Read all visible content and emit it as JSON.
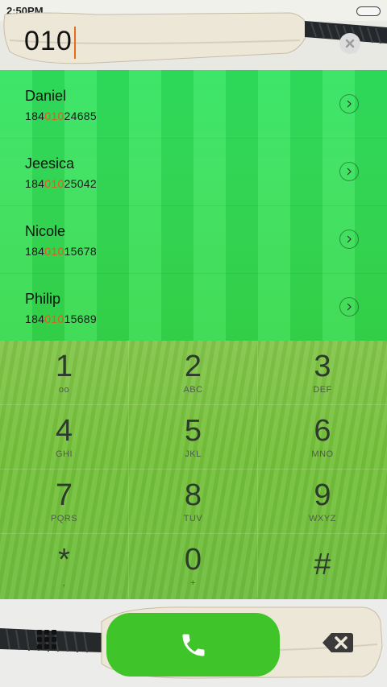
{
  "status": {
    "time": "2:50PM"
  },
  "dial": {
    "input": "010"
  },
  "contacts": [
    {
      "name": "Daniel",
      "number_pre": "184",
      "number_match": "010",
      "number_post": "24685"
    },
    {
      "name": "Jeesica",
      "number_pre": "184",
      "number_match": "010",
      "number_post": "25042"
    },
    {
      "name": "Nicole",
      "number_pre": "184",
      "number_match": "010",
      "number_post": "15678"
    },
    {
      "name": "Philip",
      "number_pre": "184",
      "number_match": "010",
      "number_post": "15689"
    }
  ],
  "keys": [
    {
      "digit": "1",
      "sub": "oo"
    },
    {
      "digit": "2",
      "sub": "ABC"
    },
    {
      "digit": "3",
      "sub": "DEF"
    },
    {
      "digit": "4",
      "sub": "GHI"
    },
    {
      "digit": "5",
      "sub": "JKL"
    },
    {
      "digit": "6",
      "sub": "MNO"
    },
    {
      "digit": "7",
      "sub": "PQRS"
    },
    {
      "digit": "8",
      "sub": "TUV"
    },
    {
      "digit": "9",
      "sub": "WXYZ"
    },
    {
      "digit": "*",
      "sub": ","
    },
    {
      "digit": "0",
      "sub": "+"
    },
    {
      "digit": "#",
      "sub": ""
    }
  ],
  "colors": {
    "accent": "#e8591a",
    "call": "#3fc42a",
    "list_green": "#35e058",
    "keypad_green": "#74c13a"
  },
  "icons": {
    "clear": "clear-circle-icon",
    "call": "phone-icon",
    "grid": "dialpad-grid-icon",
    "backspace": "backspace-icon",
    "detail": "chevron-right-icon"
  }
}
